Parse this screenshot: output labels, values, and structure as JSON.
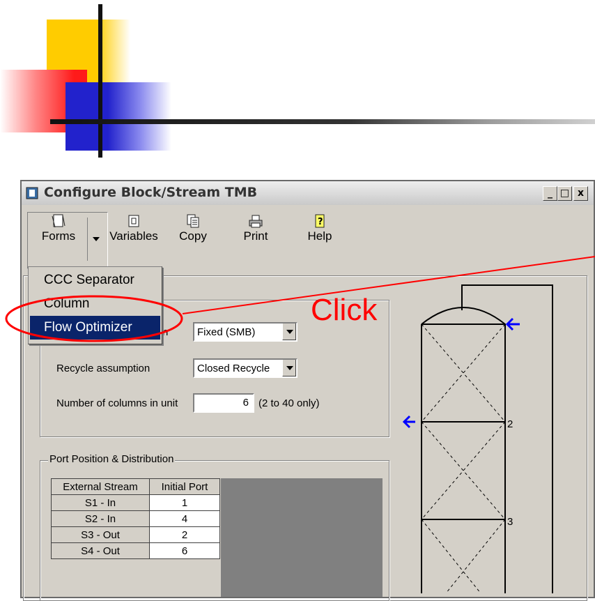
{
  "window": {
    "title": "Configure Block/Stream TMB",
    "controls": [
      "_",
      "□",
      "x"
    ]
  },
  "toolbar": {
    "forms": "Forms",
    "variables": "Variables",
    "copy": "Copy",
    "print": "Print",
    "help": "Help"
  },
  "menu": {
    "items": [
      "CCC Separator",
      "Column",
      "Flow Optimizer"
    ],
    "selected": "Flow Optimizer"
  },
  "settings": {
    "partial_label": "n",
    "mode_value": "Fixed (SMB)",
    "recycle_label": "Recycle assumption",
    "recycle_value": "Closed Recycle",
    "columns_label": "Number of columns in unit",
    "columns_value": "6",
    "columns_hint": "(2 to 40 only)"
  },
  "ports": {
    "legend": "Port Position & Distribution",
    "headers": [
      "External Stream",
      "Initial Port"
    ],
    "rows": [
      {
        "stream": "S1 - In",
        "port": "1"
      },
      {
        "stream": "S2 - In",
        "port": "4"
      },
      {
        "stream": "S3 - Out",
        "port": "2"
      },
      {
        "stream": "S4 - Out",
        "port": "6"
      }
    ]
  },
  "diagram": {
    "labels": [
      "2",
      "3"
    ]
  },
  "annotation": {
    "text": "Click",
    "color": "#ff0000"
  },
  "colors": {
    "accent_yellow": "#ffcc00",
    "accent_red": "#ff1a1a",
    "accent_blue": "#2222cc",
    "menu_highlight": "#0a246a",
    "arrow_blue": "#0000ff"
  }
}
